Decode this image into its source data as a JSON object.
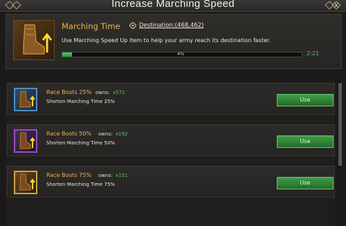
{
  "window": {
    "title": "Increase Marching Speed"
  },
  "header": {
    "name": "Marching Time",
    "destination_link": "Destination:(468,462)",
    "description": "Use Marching Speed Up item to help your army reach its destination faster.",
    "progress_label": "4%",
    "progress_fraction": 0.04,
    "time_remaining": "2:21",
    "icon": "boots-speed-icon"
  },
  "items": [
    {
      "name": "Race Boots 25%",
      "owns_label": "owns:",
      "owns_count": "x572",
      "description": "Shorten Marching Time 25%",
      "button_label": "Use",
      "rarity_color": "#4f8ec7",
      "icon": "race-boots-icon"
    },
    {
      "name": "Race Boots 50%",
      "owns_label": "owns:",
      "owns_count": "x192",
      "description": "Shorten Marching Time 50%",
      "button_label": "Use",
      "rarity_color": "#9a4fc2",
      "icon": "race-boots-icon"
    },
    {
      "name": "Race Boots 75%",
      "owns_label": "owns:",
      "owns_count": "x151",
      "description": "Shorten Marching Time 75%",
      "button_label": "Use",
      "rarity_color": "#d3a24b",
      "icon": "race-boots-icon"
    }
  ],
  "colors": {
    "accent_gold": "#f0b24a",
    "success_green": "#58c457",
    "button_green": "#3f9e46"
  }
}
